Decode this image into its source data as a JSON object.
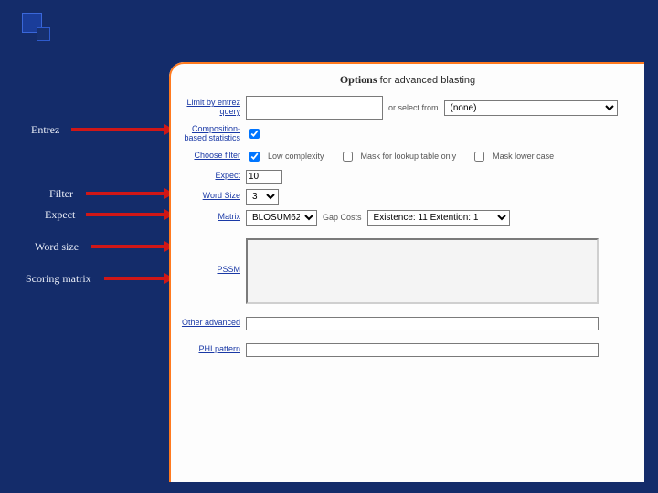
{
  "decor": {},
  "annotations": {
    "entrez": "Entrez",
    "filter": "Filter",
    "expect": "Expect",
    "wordsize": "Word size",
    "matrix": "Scoring matrix"
  },
  "form": {
    "options_title_bold": "Options",
    "options_title_rest": " for advanced blasting",
    "entrez": {
      "label": "Limit by entrez query",
      "value": "",
      "or_select_from": "or select from",
      "dropdown_value": "(none)"
    },
    "compstats": {
      "label": "Composition-based statistics",
      "checked": true
    },
    "filter": {
      "label": "Choose filter",
      "low_complexity_checked": true,
      "low_complexity_label": "Low complexity",
      "mask_lookup_checked": false,
      "mask_lookup_label": "Mask for lookup table only",
      "mask_lower_checked": false,
      "mask_lower_label": "Mask lower case"
    },
    "expect": {
      "label": "Expect",
      "value": "10"
    },
    "wordsize": {
      "label": "Word Size",
      "value": "3"
    },
    "matrix": {
      "label": "Matrix",
      "value": "BLOSUM62",
      "gapcosts_label": "Gap Costs",
      "gapcosts_value": "Existence: 11 Extention: 1"
    },
    "pssm": {
      "label": "PSSM",
      "value": ""
    },
    "other": {
      "label": "Other advanced",
      "value": ""
    },
    "phi": {
      "label": "PHI pattern",
      "value": ""
    }
  }
}
